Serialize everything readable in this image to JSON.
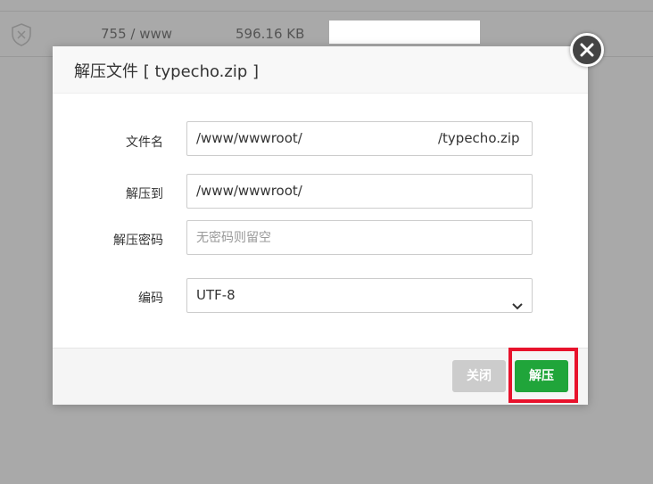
{
  "background_row": {
    "permission": "755 / www",
    "size": "596.16 KB"
  },
  "dialog": {
    "title": "解压文件 [ typecho.zip ]",
    "fields": {
      "filename": {
        "label": "文件名",
        "value_prefix": "/www/wwwroot/",
        "value_suffix": "/typecho.zip"
      },
      "extract_to": {
        "label": "解压到",
        "value": "/www/wwwroot/"
      },
      "password": {
        "label": "解压密码",
        "placeholder": "无密码则留空"
      },
      "encoding": {
        "label": "编码",
        "selected": "UTF-8"
      }
    },
    "buttons": {
      "close": "关闭",
      "extract": "解压"
    }
  },
  "colors": {
    "primary_green": "#20a53a",
    "highlight_red": "#e8122c",
    "disabled_gray": "#cccccc"
  },
  "icons": {
    "shield": "shield-x-icon",
    "close": "close-icon",
    "dropdown": "chevron-down-icon"
  }
}
